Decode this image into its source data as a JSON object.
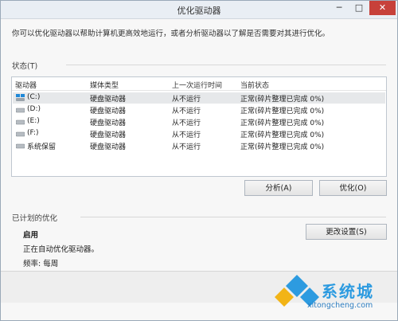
{
  "window": {
    "title": "优化驱动器",
    "minimize": "─",
    "maximize": "□",
    "close": "✕"
  },
  "description": "你可以优化驱动器以帮助计算机更高效地运行，或者分析驱动器以了解是否需要对其进行优化。",
  "status": {
    "label": "状态(T)",
    "columns": [
      "驱动器",
      "媒体类型",
      "上一次运行时间",
      "当前状态"
    ],
    "rows": [
      {
        "drive": "(C:)",
        "media": "硬盘驱动器",
        "last_run": "从不运行",
        "state": "正常(碎片整理已完成 0%)",
        "icon": "windows-drive-icon"
      },
      {
        "drive": "(D:)",
        "media": "硬盘驱动器",
        "last_run": "从不运行",
        "state": "正常(碎片整理已完成 0%)",
        "icon": "drive-icon"
      },
      {
        "drive": "(E:)",
        "media": "硬盘驱动器",
        "last_run": "从不运行",
        "state": "正常(碎片整理已完成 0%)",
        "icon": "drive-icon"
      },
      {
        "drive": "(F:)",
        "media": "硬盘驱动器",
        "last_run": "从不运行",
        "state": "正常(碎片整理已完成 0%)",
        "icon": "drive-icon"
      },
      {
        "drive": "系统保留",
        "media": "硬盘驱动器",
        "last_run": "从不运行",
        "state": "正常(碎片整理已完成 0%)",
        "icon": "drive-icon"
      }
    ]
  },
  "buttons": {
    "analyze": "分析(A)",
    "optimize": "优化(O)",
    "change_settings": "更改设置(S)"
  },
  "scheduled": {
    "label": "已计划的优化",
    "state": "启用",
    "detail": "正在自动优化驱动器。",
    "frequency": "频率: 每周"
  },
  "watermark": {
    "text": "系统城",
    "url": "xitongcheng.com",
    "accent": "#2d9be0"
  }
}
